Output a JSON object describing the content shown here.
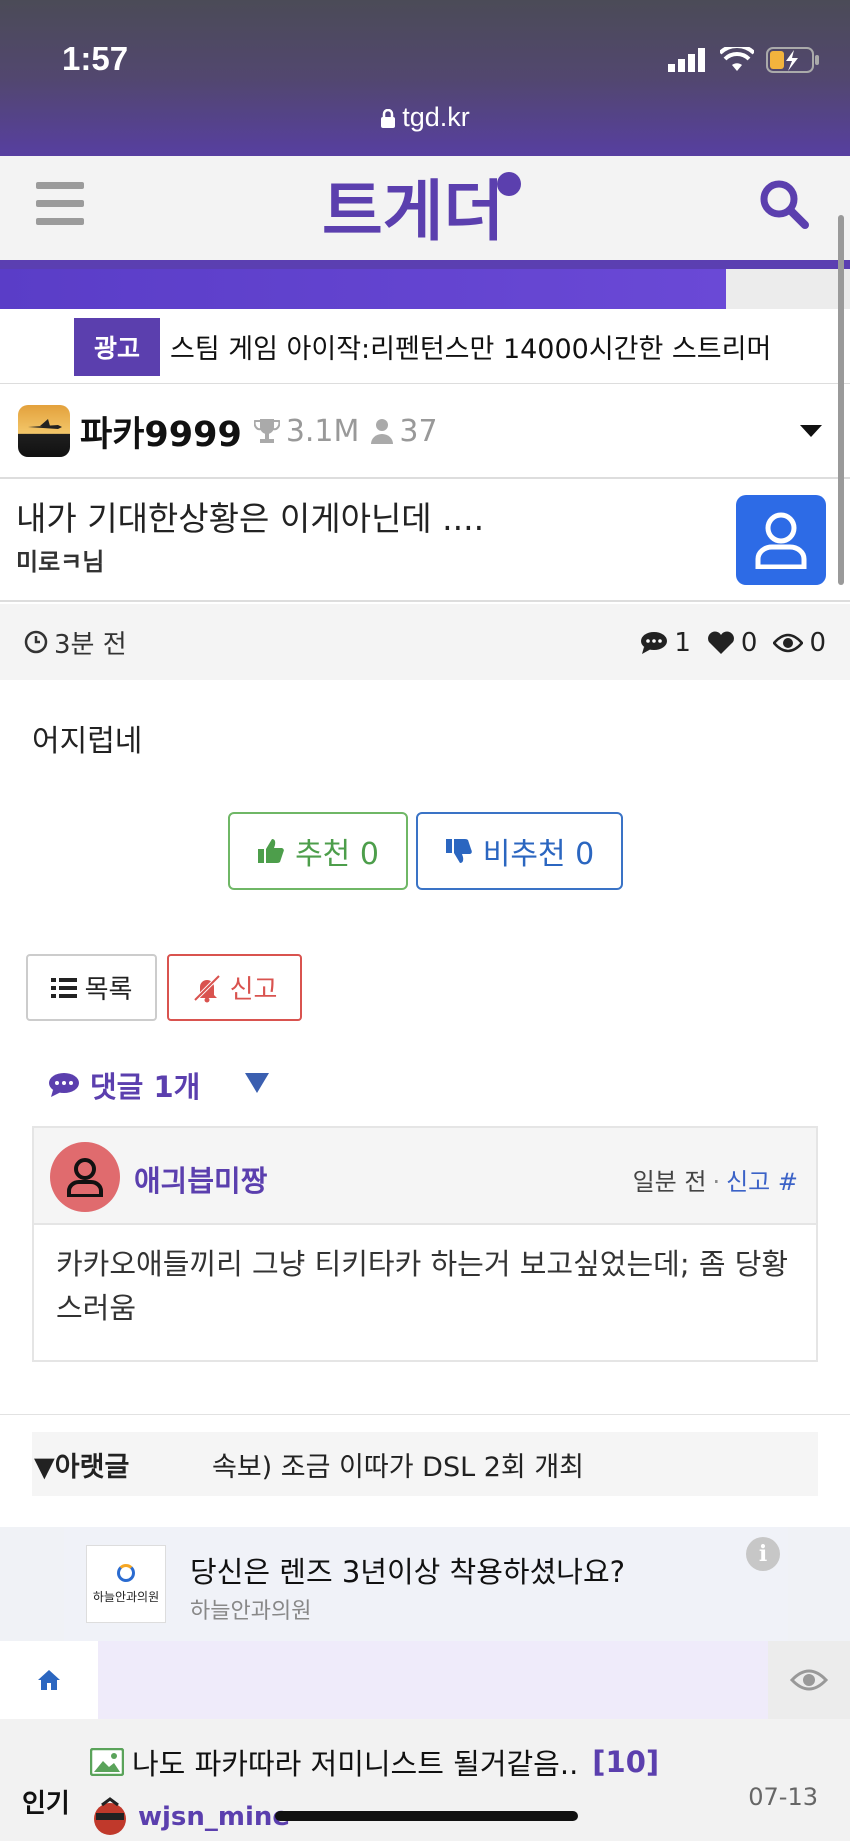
{
  "status": {
    "time": "1:57",
    "url": "tgd.kr"
  },
  "header": {
    "logo_text": "트게더"
  },
  "progress": {
    "fraction": 0.854
  },
  "ad_line": {
    "badge": "광고",
    "text": "스팀 게임 아이작:리펜턴스만 14000시간한 스트리머"
  },
  "author": {
    "name": "파카9999",
    "points": "3.1M",
    "members": "37"
  },
  "post": {
    "title": "내가 기대한상황은 이게아닌데 ....",
    "author_line": "미로ㅋ님",
    "time": "3분 전",
    "comments": "1",
    "likes": "0",
    "views": "0",
    "body": "어지럽네",
    "upvote_label": "추천 0",
    "downvote_label": "비추천 0"
  },
  "actions": {
    "list_label": "목록",
    "report_label": "신고"
  },
  "comments_section": {
    "header": "댓글 1개",
    "items": [
      {
        "name": "애긔븝미짱",
        "time": "일분 전",
        "report": "신고",
        "hash": "#",
        "text": "카카오애들끼리 그냥 티키타카 하는거 보고싶었는데; 좀 당황스러움"
      }
    ]
  },
  "next_post": {
    "label": "▼아랫글",
    "title": "속보) 조금 이따가 DSL 2회 개최"
  },
  "ad_card": {
    "logo_text": "하늘안과의원",
    "title": "당신은 렌즈 3년이상 착용하셨나요?",
    "sponsor": "하늘안과의원",
    "info": "i"
  },
  "popular": {
    "label": "인기",
    "title": "나도 파카따라 저미니스트 될거같음..",
    "count": "[10]",
    "user": "wjsn_mine",
    "date": "07-13"
  },
  "colors": {
    "brand": "#5b3fae",
    "upvote": "#4d9e4b",
    "downvote": "#2b66c0",
    "report": "#d9534f",
    "user_button": "#2d6be6"
  },
  "icons": [
    "lock-icon",
    "menu-icon",
    "search-icon",
    "trophy-icon",
    "person-icon",
    "user-icon",
    "clock-icon",
    "comment-icon",
    "heart-icon",
    "eye-icon",
    "thumbs-up-icon",
    "thumbs-down-icon",
    "list-icon",
    "bell-slash-icon",
    "home-icon",
    "image-icon",
    "info-icon"
  ]
}
